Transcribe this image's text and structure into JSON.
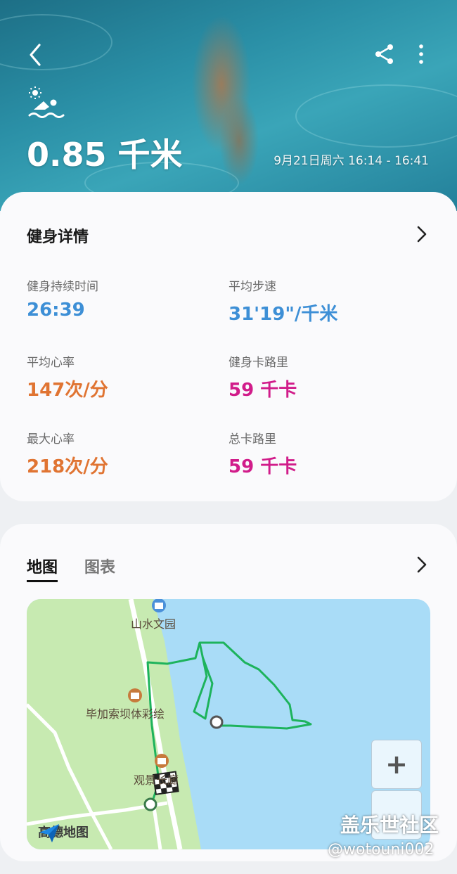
{
  "header": {
    "distance": "0.85 千米",
    "datetime": "9月21日周六 16:14 - 16:41"
  },
  "details": {
    "title": "健身详情",
    "stats": [
      {
        "label": "健身持续时间",
        "value": "26:39"
      },
      {
        "label": "平均步速",
        "value": "31'19\"/千米"
      },
      {
        "label": "平均心率",
        "value": "147次/分"
      },
      {
        "label": "健身卡路里",
        "value": "59 千卡"
      },
      {
        "label": "最大心率",
        "value": "218次/分"
      },
      {
        "label": "总卡路里",
        "value": "59 千卡"
      }
    ]
  },
  "map_section": {
    "tabs": [
      "地图",
      "图表"
    ],
    "active_tab": "地图",
    "places": [
      "山水文园",
      "毕加索坝体彩绘",
      "观景长廊"
    ],
    "provider": "高德地图",
    "zoom_in": "+"
  },
  "watermark": {
    "line1": "盖乐世社区",
    "line2": "@wotouni002"
  },
  "colors": {
    "accent_blue": "#3d8fd6",
    "accent_orange": "#e07432",
    "accent_magenta": "#d11c8a",
    "route_green": "#1db35c",
    "water": "#a9dcf7",
    "land": "#c7eab1"
  },
  "icons": [
    "back-arrow-icon",
    "share-icon",
    "more-vertical-icon",
    "swimming-icon",
    "chevron-right-icon",
    "landmark-icon",
    "finish-flag-icon",
    "amap-logo-icon"
  ]
}
